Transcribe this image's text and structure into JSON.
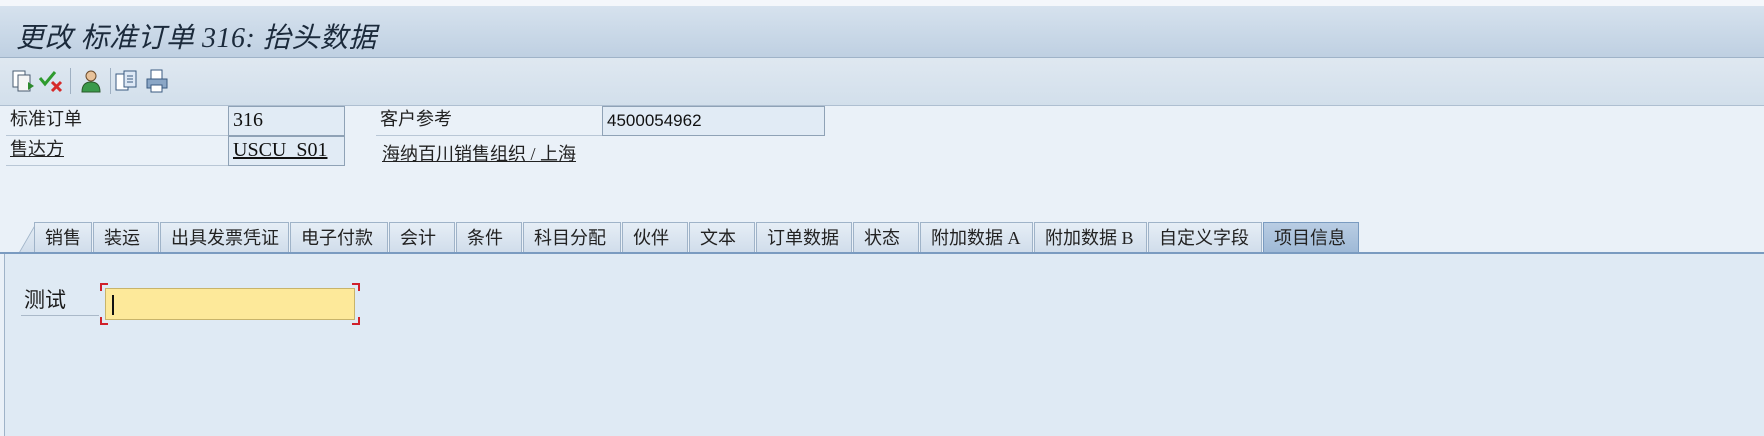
{
  "window": {
    "title": "更改 标准订单 316: 抬头数据"
  },
  "toolbar": {
    "buttons": [
      {
        "icon": "document-display-icon"
      },
      {
        "icon": "check-cancel-icon"
      },
      {
        "icon": "person-icon"
      },
      {
        "icon": "document-overview-icon"
      },
      {
        "icon": "print-icon"
      }
    ]
  },
  "header": {
    "order_label": "标准订单",
    "order_value": "316",
    "customer_ref_label": "客户参考",
    "customer_ref_value": "4500054962",
    "sold_to_label": "售达方",
    "sold_to_value": "USCU_S01",
    "sold_to_name": "海纳百川销售组织 / 上海"
  },
  "tabs": [
    {
      "label": "销售"
    },
    {
      "label": "装运"
    },
    {
      "label": "出具发票凭证"
    },
    {
      "label": "电子付款"
    },
    {
      "label": "会计"
    },
    {
      "label": "条件"
    },
    {
      "label": "科目分配"
    },
    {
      "label": "伙伴"
    },
    {
      "label": "文本"
    },
    {
      "label": "订单数据"
    },
    {
      "label": "状态"
    },
    {
      "label": "附加数据 A"
    },
    {
      "label": "附加数据 B"
    },
    {
      "label": "自定义字段"
    },
    {
      "label": "项目信息",
      "active": true
    }
  ],
  "content": {
    "test_label": "测试",
    "test_value": ""
  },
  "colors": {
    "background": "#eaf1f8",
    "active_tab": "#9db8d6",
    "input_highlight": "#fde99a",
    "focus_corner": "#d0202a"
  }
}
